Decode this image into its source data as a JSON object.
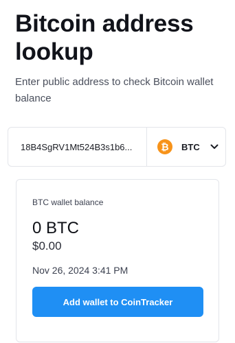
{
  "header": {
    "title": "Bitcoin address lookup",
    "subtitle": "Enter public address to check Bitcoin wallet balance"
  },
  "lookup": {
    "address_value": "18B4SgRV1Mt524B3s1b6...",
    "currency": {
      "icon": "bitcoin-icon",
      "icon_glyph": "₿",
      "label": "BTC"
    }
  },
  "balance_card": {
    "label": "BTC wallet balance",
    "btc_amount": "0 BTC",
    "usd_amount": "$0.00",
    "timestamp": "Nov 26, 2024 3:41 PM",
    "button_label": "Add wallet to CoinTracker"
  },
  "colors": {
    "accent": "#1f8ff4",
    "bitcoin": "#f7931a",
    "border": "#e3e5ea",
    "text": "#11131a"
  }
}
